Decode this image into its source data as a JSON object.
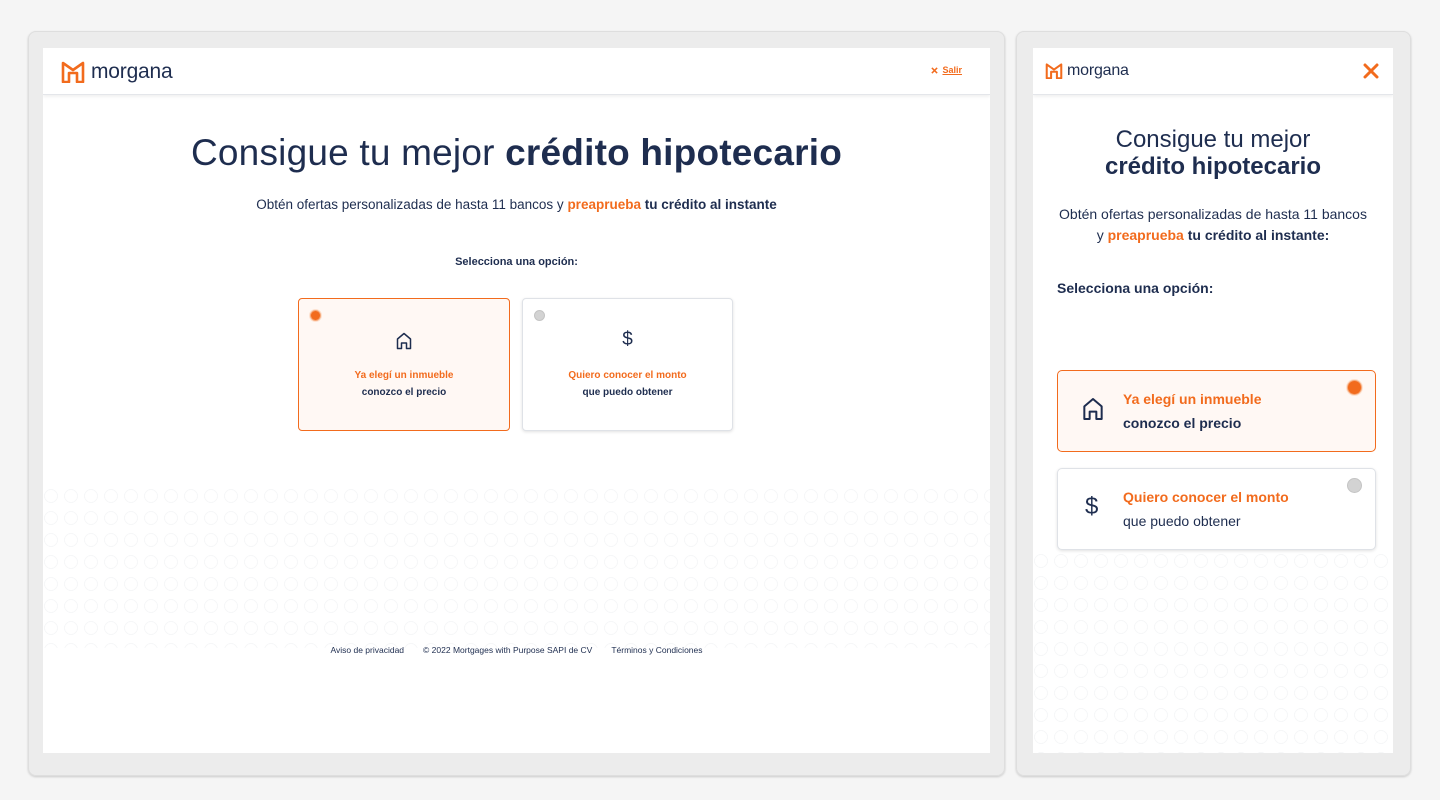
{
  "brand": {
    "name": "morgana",
    "accent": "#f26b1d",
    "navy": "#1e2d4f"
  },
  "desktop": {
    "exit_label": "Salir",
    "title_regular": "Consigue tu mejor",
    "title_bold": "crédito hipotecario",
    "subtitle_prefix": "Obtén ofertas personalizadas de hasta 11 bancos y",
    "subtitle_highlight": "preaprueba",
    "subtitle_bold": "tu crédito al instante",
    "select_prompt": "Selecciona una opción:",
    "options": [
      {
        "icon": "house-icon",
        "title": "Ya elegí un inmueble",
        "description": "conozco el precio",
        "selected": true
      },
      {
        "icon": "dollar-icon",
        "title": "Quiero conocer el monto",
        "description": "que puedo obtener",
        "selected": false
      }
    ],
    "footer": {
      "privacy": "Aviso de privacidad",
      "copyright": "© 2022 Mortgages with Purpose SAPI de CV",
      "terms": "Términos y Condiciones"
    }
  },
  "mobile": {
    "title_line1": "Consigue tu mejor",
    "title_line2": "crédito hipotecario",
    "subtitle_prefix": "Obtén ofertas personalizadas de hasta 11 bancos y",
    "subtitle_highlight": "preaprueba",
    "subtitle_bold": "tu crédito al instante:",
    "select_prompt": "Selecciona una opción:",
    "options": [
      {
        "icon": "house-icon",
        "title": "Ya elegí un inmueble",
        "description": "conozco el precio",
        "selected": true
      },
      {
        "icon": "dollar-icon",
        "title": "Quiero conocer el monto",
        "description": "que puedo obtener",
        "selected": false
      }
    ]
  }
}
